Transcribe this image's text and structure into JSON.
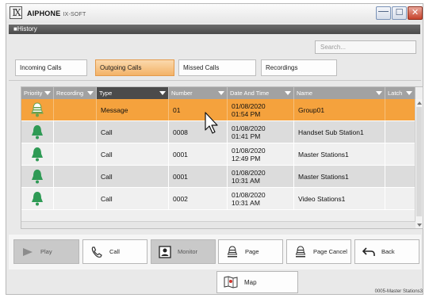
{
  "window": {
    "logo": "IX",
    "title": "AIPHONE",
    "subtitle": "IX-SOFT",
    "minimize": "—",
    "maximize": "☐",
    "close": "✕"
  },
  "section": {
    "title": "■History"
  },
  "search": {
    "placeholder": "Search..."
  },
  "tabs": [
    {
      "label": "Incoming Calls",
      "active": false
    },
    {
      "label": "Outgoing Calls",
      "active": true
    },
    {
      "label": "Missed Calls",
      "active": false
    },
    {
      "label": "Recordings",
      "active": false
    }
  ],
  "table": {
    "columns": [
      "Priority",
      "Recording",
      "Type",
      "Number",
      "Date And Time",
      "Name",
      "Latch"
    ],
    "rows": [
      {
        "icon": "message-bell-icon",
        "type": "Message",
        "number": "01",
        "date": "01/08/2020",
        "time": "01:54 PM",
        "name": "Group01",
        "selected": true
      },
      {
        "icon": "bell-icon",
        "type": "Call",
        "number": "0008",
        "date": "01/08/2020",
        "time": "01:41 PM",
        "name": "Handset Sub Station1",
        "selected": false
      },
      {
        "icon": "bell-icon",
        "type": "Call",
        "number": "0001",
        "date": "01/08/2020",
        "time": "12:49 PM",
        "name": "Master Stations1",
        "selected": false
      },
      {
        "icon": "bell-icon",
        "type": "Call",
        "number": "0001",
        "date": "01/08/2020",
        "time": "10:31 AM",
        "name": "Master Stations1",
        "selected": false
      },
      {
        "icon": "bell-icon",
        "type": "Call",
        "number": "0002",
        "date": "01/08/2020",
        "time": "10:31 AM",
        "name": "Video Stations1",
        "selected": false
      }
    ]
  },
  "actions": {
    "play": "Play",
    "call": "Call",
    "monitor": "Monitor",
    "page": "Page",
    "page_cancel": "Page Cancel",
    "back": "Back",
    "map": "Map"
  },
  "status": {
    "station": "0005-Master Stations3"
  },
  "colors": {
    "selected_row": "#f5a23d",
    "bell_green": "#2f9a55",
    "active_tab": "#f3b267"
  }
}
